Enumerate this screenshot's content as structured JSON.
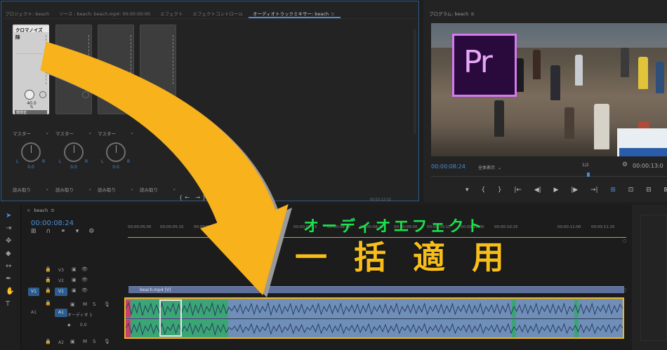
{
  "tabs": [
    {
      "label": "プロジェクト: beach"
    },
    {
      "label": "ソース : beach: beach.mp4: 00:00:00:00"
    },
    {
      "label": "エフェクト"
    },
    {
      "label": "エフェクトコントロール"
    },
    {
      "label": "オーディオトラックミキサー: beach",
      "active": true
    }
  ],
  "mixer": {
    "channels": [
      {
        "effect_label": "クロマノイズ除",
        "value": "40.0",
        "unit": "%",
        "mode_label": "環境音",
        "master": "マスター",
        "pan_value": "0.0",
        "read_mode": "読み取り",
        "active": true
      },
      {
        "master": "マスター",
        "pan_value": "0.0",
        "read_mode": "読み取り"
      },
      {
        "master": "マスター",
        "pan_value": "0.0",
        "read_mode": "読み取り"
      },
      {
        "read_mode": "読み取り"
      }
    ],
    "pan_left": "L",
    "pan_right": "R",
    "bottom_controls": "{← →} ▶",
    "bottom_timecode": "00:00:13:02"
  },
  "program": {
    "title": "プログラム: beach",
    "logo_text": "Pr",
    "timecode": "00:00:08:24",
    "fit_label": "全体表示",
    "resolution": "1/2",
    "duration": "00:00:13:0",
    "controls": [
      "▾",
      "{",
      "}",
      "|←",
      "◀|",
      "▶",
      "|▶",
      "→|",
      "⊞",
      "⊡",
      "⊟",
      "⊠"
    ]
  },
  "timeline": {
    "sequence_name": "beach",
    "timecode": "00:00:08:24",
    "ruler_ticks": [
      "00:00:05:00",
      "00:00:05:15",
      "00:00:06:00",
      "00:00:06:15",
      "00:00:07:00",
      "00:00:07:15",
      "00:00:08:00",
      "00:00:08:15",
      "00:00:09:00",
      "00:00:09:15",
      "00:00:10:00",
      "00:00:10:15",
      "00:00:11:00",
      "00:00:11:15"
    ],
    "tracks": {
      "v3": "V3",
      "v2": "V2",
      "v1_source": "V1",
      "v1": "V1",
      "a1_source": "A1",
      "a1": "A1",
      "a1_m": "M",
      "a1_s": "S",
      "a1_sub": "オーディオ 1",
      "a1_vol": "0.0",
      "a2": "A2",
      "a2_m": "M",
      "a2_s": "S"
    },
    "video_clip_name": "beach.mp4 [V]"
  },
  "overlay": {
    "subtitle": "オーディオエフェクト",
    "title": "一括適用"
  },
  "colors": {
    "accent_blue": "#4a8cd6",
    "arrow_orange": "#f7b21c",
    "overlay_green": "#19e34b",
    "highlight_orange": "#f3b41c",
    "audio_clip": "#6f8fb8",
    "audio_green": "#3aa673"
  }
}
